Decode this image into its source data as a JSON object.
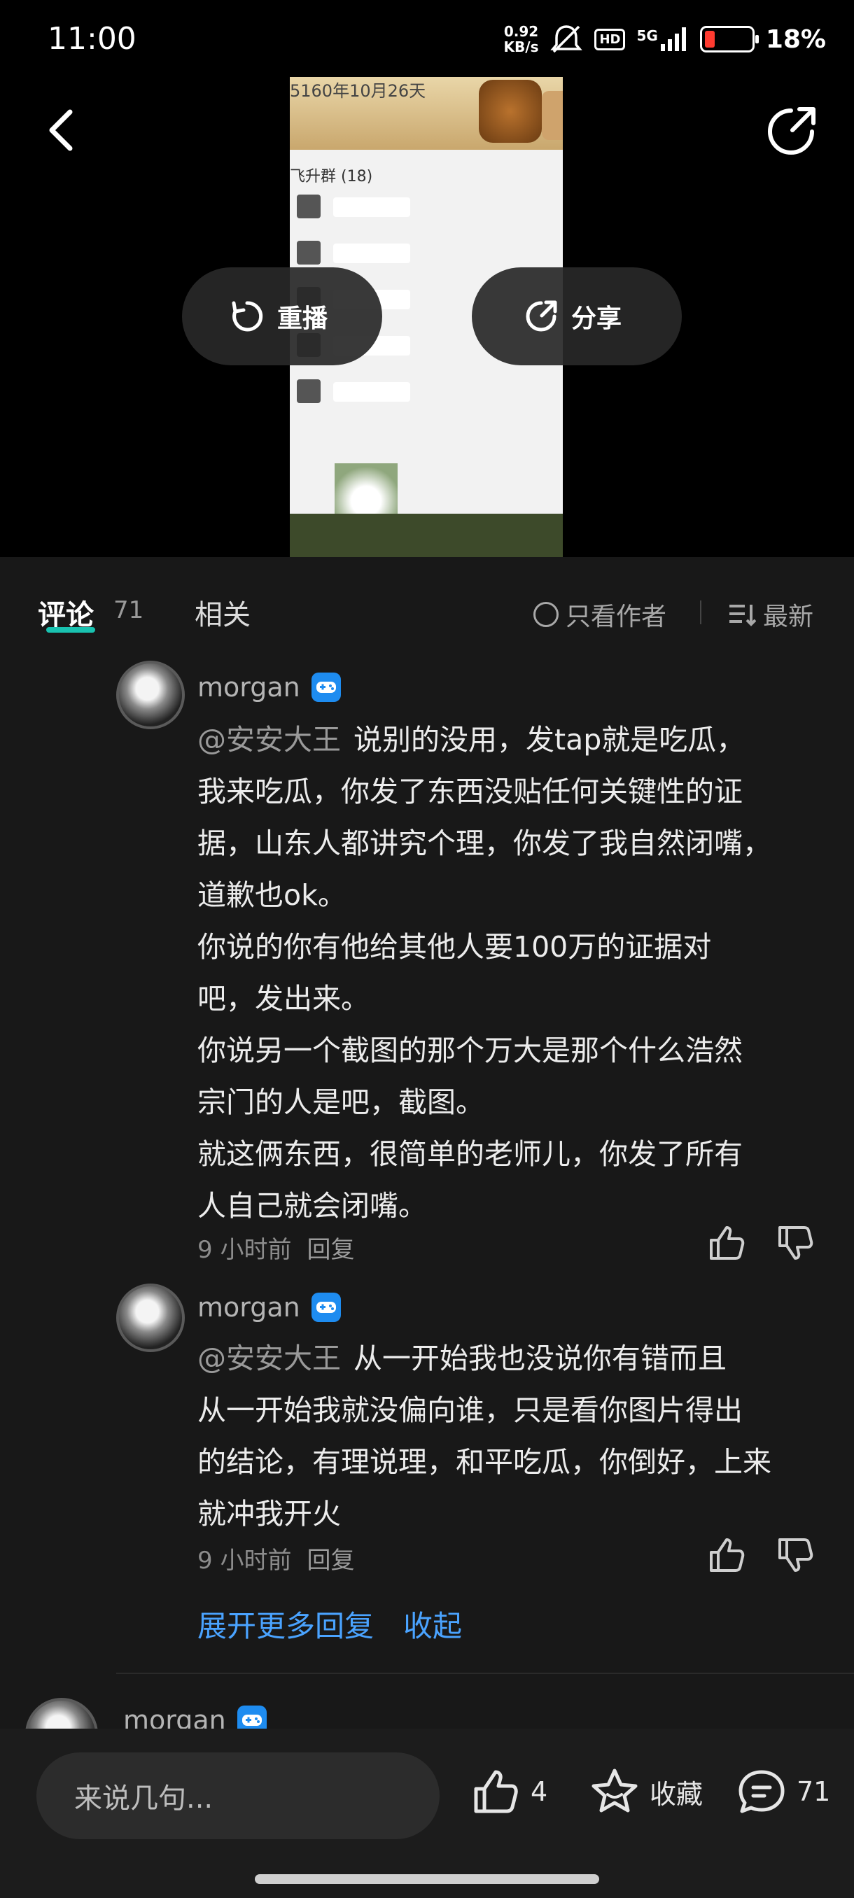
{
  "status_bar": {
    "time": "11:00",
    "net_speed_value": "0.92",
    "net_speed_unit": "KB/s",
    "hd": "HD",
    "signal": "5G",
    "battery": "18%"
  },
  "video": {
    "overlay_date": "5160年10月26天",
    "overlay_group": "飞升群 (18)",
    "replay_label": "重播",
    "share_label": "分享"
  },
  "tabs": {
    "comments_label": "评论",
    "comments_count": "71",
    "related_label": "相关",
    "only_author_label": "只看作者",
    "sort_label": "最新"
  },
  "replies": [
    {
      "username": "morgan",
      "mention": "@安安大王",
      "text": "说别的没用，发tap就是吃瓜，\n我来吃瓜，你发了东西没贴任何关键性的证\n据，山东人都讲究个理，你发了我自然闭嘴，\n道歉也ok。\n你说的你有他给其他人要100万的证据对\n吧，发出来。\n你说另一个截图的那个万大是那个什么浩然\n宗门的人是吧，截图。\n就这俩东西，很简单的老师儿，你发了所有\n人自己就会闭嘴。",
      "time": "9 小时前",
      "reply_label": "回复"
    },
    {
      "username": "morgan",
      "mention": "@安安大王",
      "text": "从一开始我也没说你有错而且\n从一开始我就没偏向谁，只是看你图片得出\n的结论，有理说理，和平吃瓜，你倒好，上来\n就冲我开火",
      "time": "9 小时前",
      "reply_label": "回复"
    }
  ],
  "expand_more": "展开更多回复",
  "collapse": "收起",
  "next_comment_username": "morgan",
  "bottom_bar": {
    "input_placeholder": "来说几句...",
    "like_count": "4",
    "favorite_label": "收藏",
    "comment_count": "71"
  },
  "colors": {
    "accent_tab": "#19c2b0",
    "link_blue": "#4aa3ff",
    "badge_blue": "#1e8cf0",
    "battery_red": "#ff3b30"
  }
}
